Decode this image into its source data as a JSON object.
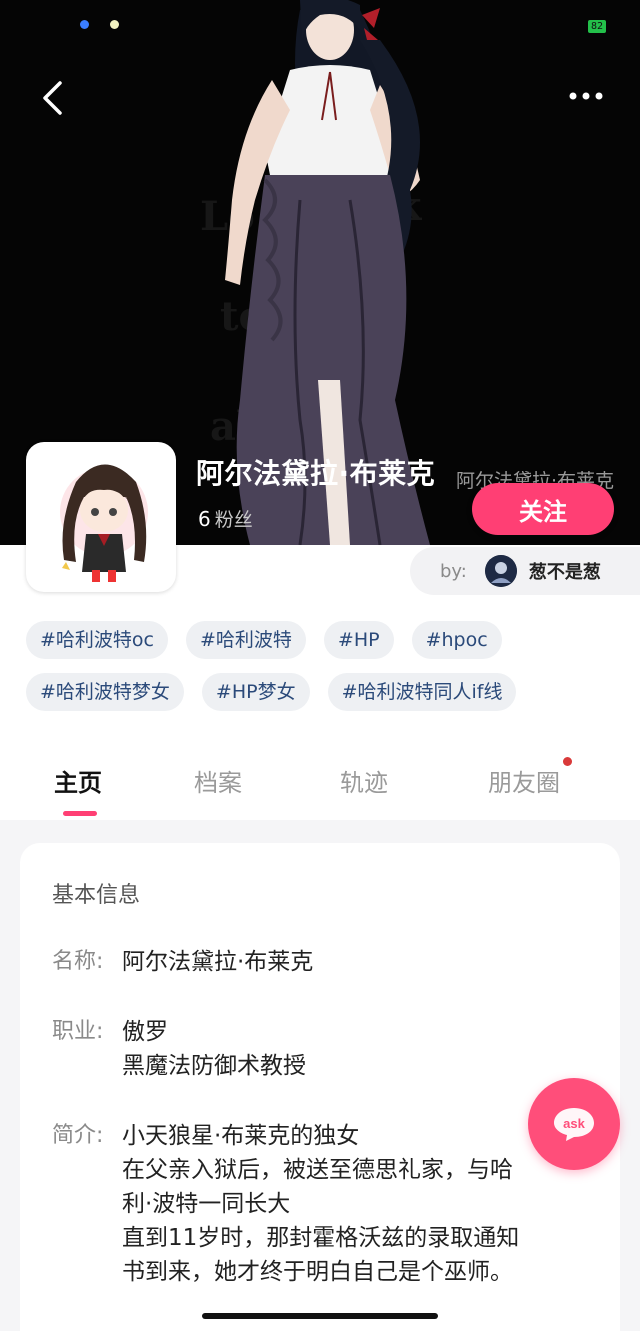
{
  "status_bar": {
    "battery": "82"
  },
  "header": {
    "back_icon": "chevron-left-icon",
    "more_icon": "more-dots-icon"
  },
  "profile": {
    "name": "阿尔法黛拉·布莱克",
    "alt_name": "阿尔法黛拉·布莱克",
    "fans_count": "6",
    "fans_label": "粉丝",
    "follow_label": "关注",
    "by_label": "by:",
    "author_name": "葱不是葱"
  },
  "tags": [
    [
      "#哈利波特oc",
      "#哈利波特",
      "#HP",
      "#hpoc"
    ],
    [
      "#哈利波特梦女",
      "#HP梦女",
      "#哈利波特同人if线"
    ]
  ],
  "tabs": [
    {
      "label": "主页",
      "active": true
    },
    {
      "label": "档案",
      "active": false
    },
    {
      "label": "轨迹",
      "active": false
    },
    {
      "label": "朋友圈",
      "active": false,
      "badge": true
    }
  ],
  "info": {
    "title": "基本信息",
    "name_label": "名称:",
    "name_value": "阿尔法黛拉·布莱克",
    "job_label": "职业:",
    "job_values": [
      "傲罗",
      "黑魔法防御术教授"
    ],
    "intro_label": "简介:",
    "intro_values": [
      "小天狼星·布莱克的独女",
      "在父亲入狱后，被送至德思礼家，与哈\n利·波特一同长大",
      "直到11岁时，那封霍格沃兹的录取通知\n书到来，她才终于明白自己是个巫师。"
    ]
  },
  "ask_label": "ask",
  "colors": {
    "accent": "#ff3f74",
    "tag_text": "#2b4a7a",
    "tag_bg": "#eef0f3"
  }
}
